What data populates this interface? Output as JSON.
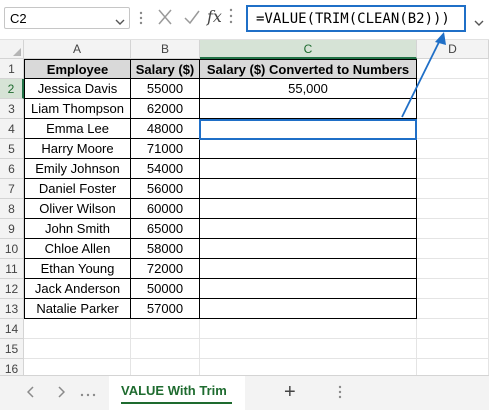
{
  "formula_bar": {
    "name_box": "C2",
    "formula": "=VALUE(TRIM(CLEAN(B2)))",
    "fx_label": "fx",
    "accent": "#1f6fc7"
  },
  "columns": [
    "A",
    "B",
    "C",
    "D"
  ],
  "selected_column": "C",
  "selected_row": "2",
  "row_numbers": [
    "1",
    "2",
    "3",
    "4",
    "5",
    "6",
    "7",
    "8",
    "9",
    "10",
    "11",
    "12",
    "13",
    "14",
    "15",
    "16"
  ],
  "table": {
    "headers": [
      "Employee",
      "Salary ($)",
      "Salary ($) Converted to Numbers"
    ],
    "rows": [
      [
        "Jessica Davis",
        "55000",
        "55,000"
      ],
      [
        "Liam Thompson",
        "62000",
        ""
      ],
      [
        "Emma Lee",
        "48000",
        ""
      ],
      [
        "Harry Moore",
        "71000",
        ""
      ],
      [
        "Emily Johnson",
        "54000",
        ""
      ],
      [
        "Daniel Foster",
        "56000",
        ""
      ],
      [
        "Oliver Wilson",
        "60000",
        ""
      ],
      [
        "John Smith",
        "65000",
        ""
      ],
      [
        "Chloe Allen",
        "58000",
        ""
      ],
      [
        "Ethan Young",
        "72000",
        ""
      ],
      [
        "Jack Anderson",
        "50000",
        ""
      ],
      [
        "Natalie Parker",
        "57000",
        ""
      ]
    ]
  },
  "sheet_tabs": {
    "active": "VALUE With Trim",
    "add_label": "+",
    "prev_icon": "chevron-left-icon",
    "next_icon": "chevron-right-icon"
  }
}
